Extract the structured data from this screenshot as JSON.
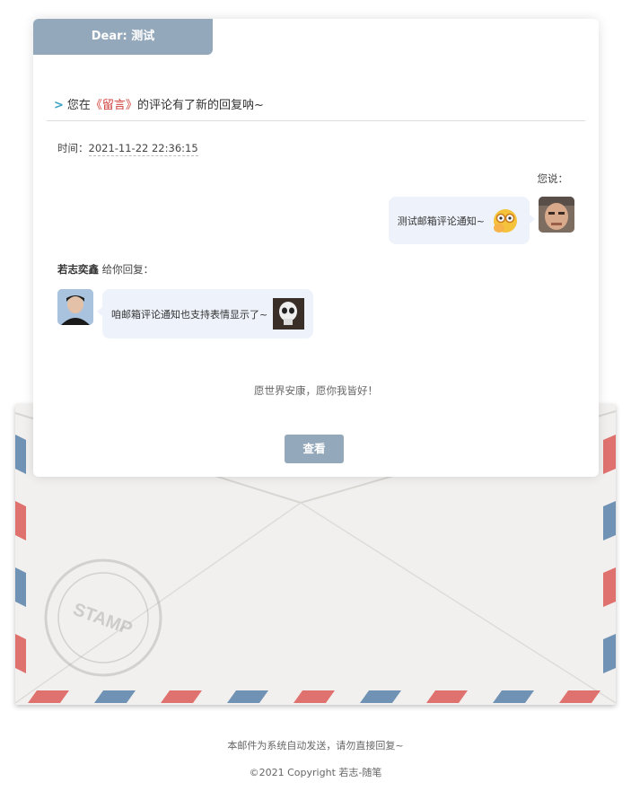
{
  "header": {
    "dear_label": "Dear: 测试"
  },
  "subject": {
    "arrow": ">",
    "prefix": "您在",
    "post_title": "《留言》",
    "suffix": "的评论有了新的回复呐~"
  },
  "meta": {
    "time_label": "时间：",
    "time_value": "2021-11-22 22:36:15"
  },
  "original_comment": {
    "label": "您说：",
    "text": "测试邮箱评论通知~"
  },
  "reply": {
    "replier_name": "若志奕鑫",
    "replier_suffix": " 给你回复：",
    "text": "咱邮箱评论通知也支持表情显示了~"
  },
  "blessing": "愿世界安康，愿你我皆好！",
  "view_button": "查看",
  "envelope": {
    "stamp_text": "STAMP"
  },
  "footer": {
    "note": "本邮件为系统自动发送，请勿直接回复~",
    "copyright": "©2021 Copyright 若志-随笔"
  },
  "colors": {
    "accent": "#94a8bb",
    "link_red": "#d0413b",
    "arrow_blue": "#3aa1c4",
    "bubble_bg": "#eef2fa",
    "stripe_red": "#d9534f",
    "stripe_blue": "#4f7aa6"
  }
}
